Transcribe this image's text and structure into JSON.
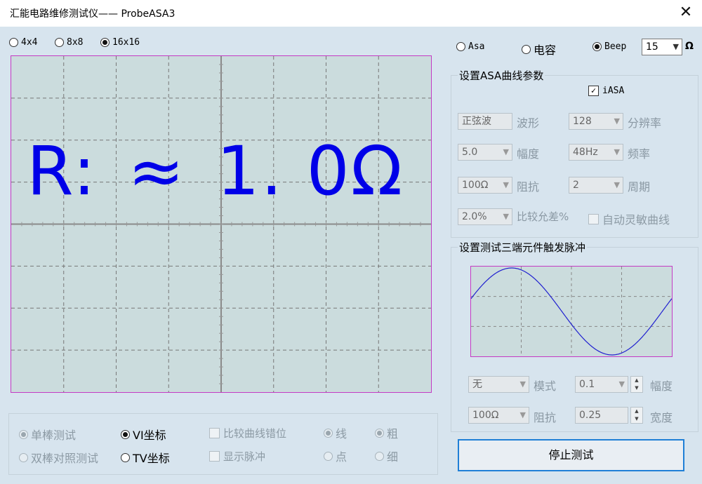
{
  "window": {
    "title": "汇能电路维修测试仪—— ProbeASA3",
    "close_glyph": "✕"
  },
  "grid_options": [
    {
      "label": "4x4",
      "selected": false
    },
    {
      "label": "8x8",
      "selected": false
    },
    {
      "label": "16x16",
      "selected": true
    }
  ],
  "scope": {
    "reading_parts": [
      "R:",
      "≈",
      "1. 0Ω"
    ]
  },
  "mode_options": [
    {
      "label": "Asa",
      "selected": false
    },
    {
      "label": "电容",
      "selected": false
    },
    {
      "label": "Beep",
      "selected": true
    }
  ],
  "beep_threshold": {
    "value": "15",
    "unit": "Ω"
  },
  "asa_group": {
    "title": "设置ASA曲线参数",
    "iasa_label": "iASA",
    "iasa_checked": true,
    "waveform": {
      "value": "正弦波",
      "label": "波形"
    },
    "resolution": {
      "value": "128",
      "label": "分辨率"
    },
    "amplitude": {
      "value": "5.0",
      "label": "幅度"
    },
    "frequency": {
      "value": "48Hz",
      "label": "频率"
    },
    "impedance": {
      "value": "100Ω",
      "label": "阻抗"
    },
    "period": {
      "value": "2",
      "label": "周期"
    },
    "tolerance": {
      "value": "2.0%",
      "label": "比较允差%"
    },
    "auto_sensitive_label": "自动灵敏曲线"
  },
  "pulse_group": {
    "title": "设置测试三端元件触发脉冲",
    "mode": {
      "value": "无",
      "label": "模式"
    },
    "amplitude": {
      "value": "0.1",
      "label": "幅度"
    },
    "impedance": {
      "value": "100Ω",
      "label": "阻抗"
    },
    "width": {
      "value": "0.25",
      "label": "宽度"
    }
  },
  "bottom": {
    "single_probe": "单棒测试",
    "dual_probe": "双棒对照测试",
    "vi_coord": "VI坐标",
    "tv_coord": "TV坐标",
    "compare_offset": "比较曲线错位",
    "show_pulse": "显示脉冲",
    "line": "线",
    "dot": "点",
    "thick": "粗",
    "thin": "细"
  },
  "stop_button": "停止测试",
  "colors": {
    "reading": "#0000e8",
    "scope_border": "#c43ac4",
    "sine": "#2020d0",
    "focus": "#1f7fd6"
  }
}
